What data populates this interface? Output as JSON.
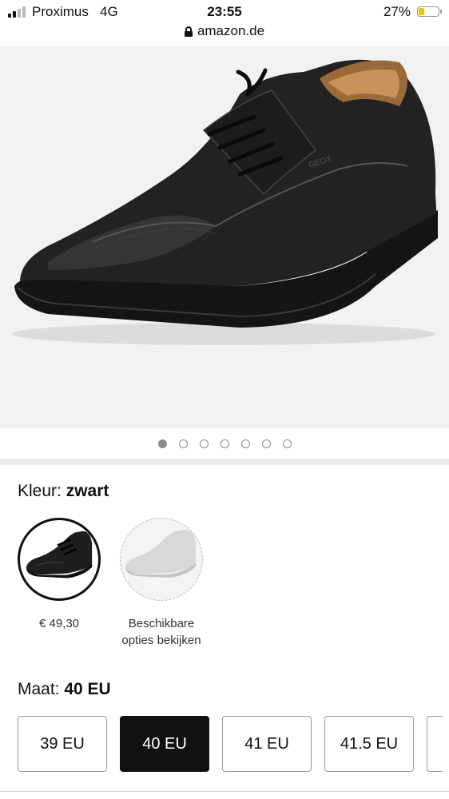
{
  "status_bar": {
    "carrier": "Proximus",
    "network": "4G",
    "time": "23:55",
    "battery": "27%",
    "battery_level": 0.27,
    "url": "amazon.de"
  },
  "gallery": {
    "image_count": 7,
    "active_index": 0
  },
  "color": {
    "label": "Kleur: ",
    "value": "zwart",
    "swatches": [
      {
        "caption": "€ 49,30",
        "selected": true
      },
      {
        "caption_line1": "Beschikbare",
        "caption_line2": "opties bekijken",
        "selected": false
      }
    ]
  },
  "size": {
    "label": "Maat: ",
    "value": "40 EU",
    "options": [
      "39 EU",
      "40 EU",
      "41 EU",
      "41.5 EU"
    ],
    "selected_index": 1
  },
  "colors": {
    "selected_button": "#111111",
    "battery_fill": "#f0c800",
    "image_background": "#f2f2f2"
  }
}
